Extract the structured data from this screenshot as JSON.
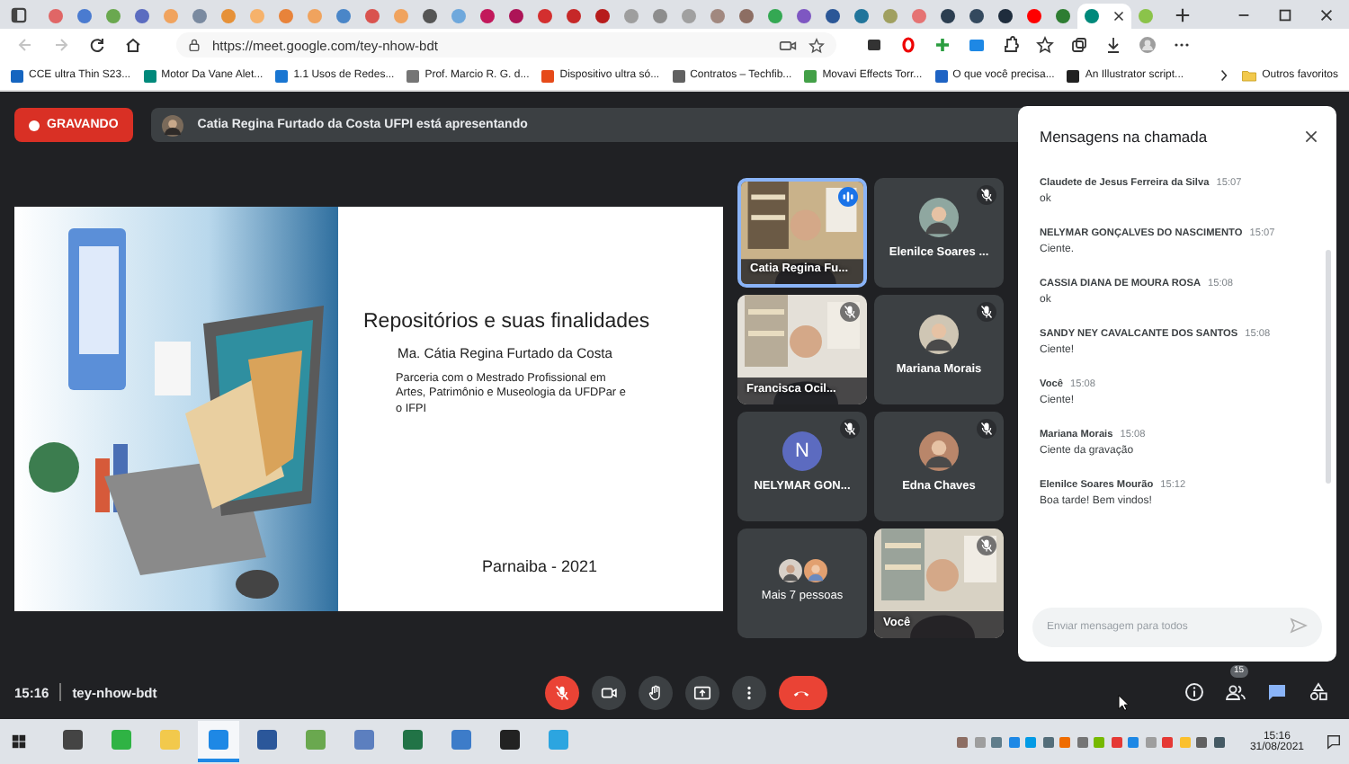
{
  "browser": {
    "tabs": [
      {
        "color": "#e06666",
        "selected": false
      },
      {
        "color": "#4a7bd0",
        "selected": false
      },
      {
        "color": "#6aa84f",
        "selected": false
      },
      {
        "color": "#5b6cc0",
        "selected": false
      },
      {
        "color": "#f0a35e",
        "selected": false
      },
      {
        "color": "#7a8aa0",
        "selected": false
      },
      {
        "color": "#e69138",
        "selected": false
      },
      {
        "color": "#f6b26b",
        "selected": false
      },
      {
        "color": "#e8833a",
        "selected": false
      },
      {
        "color": "#f0a35e",
        "selected": false
      },
      {
        "color": "#4a86c8",
        "selected": false
      },
      {
        "color": "#d9534f",
        "selected": false
      },
      {
        "color": "#f0a35e",
        "selected": false
      },
      {
        "color": "#555555",
        "selected": false
      },
      {
        "color": "#6fa8dc",
        "selected": false
      },
      {
        "color": "#c2185b",
        "selected": false
      },
      {
        "color": "#ad1457",
        "selected": false
      },
      {
        "color": "#d32f2f",
        "selected": false
      },
      {
        "color": "#c62828",
        "selected": false
      },
      {
        "color": "#b71c1c",
        "selected": false
      },
      {
        "color": "#9e9e9e",
        "selected": false
      },
      {
        "color": "#8d8d8d",
        "selected": false
      },
      {
        "color": "#a0a0a0",
        "selected": false
      },
      {
        "color": "#a1887f",
        "selected": false
      },
      {
        "color": "#8d6e63",
        "selected": false
      },
      {
        "color": "#34a853",
        "selected": false
      },
      {
        "color": "#7e57c2",
        "selected": false
      },
      {
        "color": "#2b5797",
        "selected": false
      },
      {
        "color": "#21759b",
        "selected": false
      },
      {
        "color": "#a0a060",
        "selected": false
      },
      {
        "color": "#e57373",
        "selected": false
      },
      {
        "color": "#2c3e50",
        "selected": false
      },
      {
        "color": "#34495e",
        "selected": false
      },
      {
        "color": "#1f2d3d",
        "selected": false
      },
      {
        "color": "#ff0000",
        "selected": false
      },
      {
        "color": "#2e7d32",
        "selected": false
      },
      {
        "color": "#00897b",
        "selected": true
      },
      {
        "color": "#8bc34a",
        "selected": false
      }
    ],
    "nav": [
      {
        "kind": "back",
        "disabled": true
      },
      {
        "kind": "forward",
        "disabled": true
      },
      {
        "kind": "reload",
        "disabled": false
      },
      {
        "kind": "home",
        "disabled": false
      }
    ],
    "address": "https://meet.google.com/tey-nhow-bdt",
    "bookmarks": [
      {
        "label": "CCE ultra Thin S23...",
        "color": "#1565c0"
      },
      {
        "label": "Motor Da Vane Alet...",
        "color": "#00897b"
      },
      {
        "label": "1.1 Usos de Redes...",
        "color": "#1976d2"
      },
      {
        "label": "Prof. Marcio R. G. d...",
        "color": "#757575"
      },
      {
        "label": "Dispositivo ultra só...",
        "color": "#e64a19"
      },
      {
        "label": "Contratos – Techfib...",
        "color": "#616161"
      },
      {
        "label": "Movavi Effects Torr...",
        "color": "#43a047"
      },
      {
        "label": "O que você precisa...",
        "color": "#1e63c4"
      },
      {
        "label": "An Illustrator script...",
        "color": "#212121"
      }
    ],
    "other_bookmarks": "Outros favoritos"
  },
  "meet": {
    "recording": "GRAVANDO",
    "presenter": "Catia Regina Furtado da Costa UFPI está apresentando",
    "slide": {
      "title": "Repositórios e suas finalidades",
      "author": "Ma. Cátia Regina Furtado da Costa",
      "subtitle": "Parceria com o Mestrado Profissional em Artes, Patrimônio e Museologia da UFDPar e o IFPI",
      "footer": "Parnaiba - 2021"
    },
    "tiles": [
      {
        "kind": "video",
        "name": "Catia Regina Fu...",
        "muted": false,
        "speaking": true
      },
      {
        "kind": "avatar",
        "name": "Elenilce Soares ...",
        "muted": true,
        "speaking": false
      },
      {
        "kind": "video",
        "name": "Francisca Ocil...",
        "muted": true,
        "speaking": false
      },
      {
        "kind": "avatar",
        "name": "Mariana Morais",
        "muted": true,
        "speaking": false
      },
      {
        "kind": "initial",
        "initial": "N",
        "name": "NELYMAR GON...",
        "muted": true,
        "speaking": false
      },
      {
        "kind": "avatar",
        "name": "Edna Chaves",
        "muted": true,
        "speaking": false
      },
      {
        "kind": "more",
        "name": "Mais 7 pessoas",
        "muted": false,
        "speaking": false
      },
      {
        "kind": "video",
        "name": "Você",
        "muted": true,
        "speaking": false
      }
    ],
    "chat": {
      "title": "Mensagens na chamada",
      "messages": [
        {
          "name": "Claudete de Jesus Ferreira da Silva",
          "time": "15:07",
          "text": "ok"
        },
        {
          "name": "NELYMAR GONÇALVES DO NASCIMENTO",
          "time": "15:07",
          "text": "Ciente."
        },
        {
          "name": "CASSIA DIANA DE MOURA ROSA",
          "time": "15:08",
          "text": "ok"
        },
        {
          "name": "SANDY NEY CAVALCANTE DOS SANTOS",
          "time": "15:08",
          "text": "Ciente!"
        },
        {
          "name": "Você",
          "time": "15:08",
          "text": "Ciente!"
        },
        {
          "name": "Mariana Morais",
          "time": "15:08",
          "text": "Ciente da gravação"
        },
        {
          "name": "Elenilce Soares Mourão",
          "time": "15:12",
          "text": "Boa tarde! Bem vindos!"
        }
      ],
      "placeholder": "Enviar mensagem para todos"
    },
    "bottom": {
      "time": "15:16",
      "code": "tey-nhow-bdt",
      "controls": [
        {
          "kind": "mic",
          "on": false
        },
        {
          "kind": "camera",
          "on": true
        },
        {
          "kind": "hand"
        },
        {
          "kind": "present"
        },
        {
          "kind": "more"
        },
        {
          "kind": "hangup"
        }
      ],
      "actions": [
        {
          "kind": "info",
          "selected": false
        },
        {
          "kind": "people",
          "badge": "15",
          "selected": false
        },
        {
          "kind": "chat",
          "selected": true
        },
        {
          "kind": "activities",
          "selected": false
        }
      ]
    }
  },
  "taskbar": {
    "apps": [
      {
        "color": "#444444",
        "selected": false
      },
      {
        "color": "#2fb344",
        "selected": false
      },
      {
        "color": "#f2c94c",
        "selected": false
      },
      {
        "color": "#1e88e5",
        "selected": true
      },
      {
        "color": "#2b579a",
        "selected": false
      },
      {
        "color": "#6aa84f",
        "selected": false
      },
      {
        "color": "#5c7fbf",
        "selected": false
      },
      {
        "color": "#217346",
        "selected": false
      },
      {
        "color": "#3d7cc9",
        "selected": false
      },
      {
        "color": "#222222",
        "selected": false
      },
      {
        "color": "#2ca5e0",
        "selected": false
      }
    ],
    "tray": [
      {
        "color": "#8d6e63"
      },
      {
        "color": "#9e9e9e"
      },
      {
        "color": "#607d8b"
      },
      {
        "color": "#1e88e5"
      },
      {
        "color": "#039be5"
      },
      {
        "color": "#546e7a"
      },
      {
        "color": "#ef6c00"
      },
      {
        "color": "#757575"
      },
      {
        "color": "#76b900"
      },
      {
        "color": "#e53935"
      },
      {
        "color": "#1e88e5"
      },
      {
        "color": "#9e9e9e"
      },
      {
        "color": "#e53935"
      },
      {
        "color": "#fbc02d"
      },
      {
        "color": "#616161"
      },
      {
        "color": "#455a64"
      }
    ],
    "time": "15:16",
    "date": "31/08/2021"
  }
}
